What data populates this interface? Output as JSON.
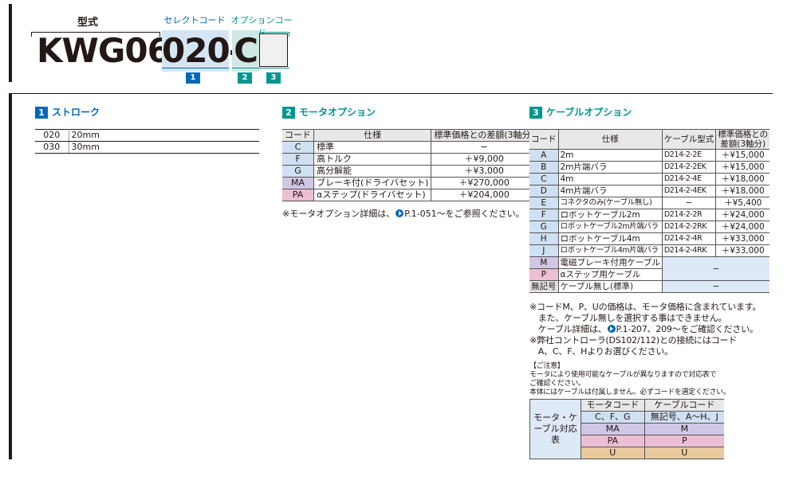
{
  "header": {
    "model_label": "型式",
    "select_code_label": "セレクトコード",
    "option_code_label": "オプションコード",
    "model_prefix": "KWG06",
    "stroke_placeholder": "020",
    "dash": "-",
    "motor_placeholder": "C",
    "badges": [
      "1",
      "2",
      "3"
    ]
  },
  "stroke": {
    "number": "1",
    "title": "ストローク",
    "rows": [
      {
        "code": "020",
        "value": "20mm"
      },
      {
        "code": "030",
        "value": "30mm"
      }
    ]
  },
  "motor": {
    "number": "2",
    "title": "モータオプション",
    "headers": [
      "コード",
      "仕様",
      "標準価格との差額(3軸分)"
    ],
    "rows": [
      {
        "code": "C",
        "spec": "標準",
        "price": "−"
      },
      {
        "code": "F",
        "spec": "高トルク",
        "price": "＋¥9,000"
      },
      {
        "code": "G",
        "spec": "高分解能",
        "price": "＋¥3,000"
      },
      {
        "code": "MA",
        "spec": "ブレーキ付(ドライバセット)",
        "price": "＋¥270,000"
      },
      {
        "code": "PA",
        "spec": "αステップ(ドライバセット)",
        "price": "＋¥204,000"
      }
    ],
    "note_before": "※モータオプション詳細は、",
    "note_after": "P.1-051〜をご参照ください。"
  },
  "cable": {
    "number": "3",
    "title": "ケーブルオプション",
    "headers": [
      "コード",
      "仕様",
      "ケーブル型式",
      "標準価格との",
      "差額(3軸分)"
    ],
    "rows": [
      {
        "code": "A",
        "spec": "2m",
        "model": "D214-2-2E",
        "price": "＋¥15,000"
      },
      {
        "code": "B",
        "spec": "2m片端バラ",
        "model": "D214-2-2EK",
        "price": "＋¥15,000"
      },
      {
        "code": "C",
        "spec": "4m",
        "model": "D214-2-4E",
        "price": "＋¥18,000"
      },
      {
        "code": "D",
        "spec": "4m片端バラ",
        "model": "D214-2-4EK",
        "price": "＋¥18,000"
      },
      {
        "code": "E",
        "spec": "コネクタのみ(ケーブル無し)",
        "model": "−",
        "price": "＋¥5,400"
      },
      {
        "code": "F",
        "spec": "ロボットケーブル2m",
        "model": "D214-2-2R",
        "price": "＋¥24,000"
      },
      {
        "code": "G",
        "spec": "ロボットケーブル2m片端バラ",
        "model": "D214-2-2RK",
        "price": "＋¥24,000"
      },
      {
        "code": "H",
        "spec": "ロボットケーブル4m",
        "model": "D214-2-4R",
        "price": "＋¥33,000"
      },
      {
        "code": "J",
        "spec": "ロボットケーブル4m片端バラ",
        "model": "D214-2-4RK",
        "price": "＋¥33,000"
      }
    ],
    "row_m": {
      "code": "M",
      "spec": "電磁ブレーキ付用ケーブル"
    },
    "row_p": {
      "code": "P",
      "spec": "αステップ用ケーブル"
    },
    "row_mp_value": "−",
    "row_none": {
      "code": "無記号",
      "spec": "ケーブル無し(標準)",
      "value": "−"
    },
    "notes": [
      "※コードM、P、Uの価格は、モータ価格に含まれています。",
      "　また、ケーブル無しを選択する事はできません。"
    ],
    "note3_before": "　ケーブル詳細は、",
    "note3_after": "P.1-207、209〜をご確認ください。",
    "notes2": [
      "※弊社コントローラ(DS102/112)との接続にはコード",
      "　A、C、F、Hよりお選びください。"
    ]
  },
  "caution": {
    "title": "【ご注意】",
    "lines": [
      "モータにより使用可能なケーブルが異なりますので対応表で",
      "ご確認ください。",
      "本体にはケーブルは付属しません。必ずコードを選定ください。"
    ]
  },
  "compat": {
    "side_label": "モータ・ケーブル対応表",
    "headers": [
      "モータコード",
      "ケーブルコード"
    ],
    "rows": [
      {
        "motor": "C、F、G",
        "cable": "無記号、A〜H、J"
      },
      {
        "motor": "MA",
        "cable": "M"
      },
      {
        "motor": "PA",
        "cable": "P"
      },
      {
        "motor": "U",
        "cable": "U"
      }
    ]
  },
  "colors": {
    "blue": "#0068b7",
    "teal": "#00968f",
    "code_blue": "#cfe0f2",
    "code_pink": "#ecbfd4",
    "code_lavender": "#cfc7e3",
    "code_tan": "#e9ca9f"
  }
}
